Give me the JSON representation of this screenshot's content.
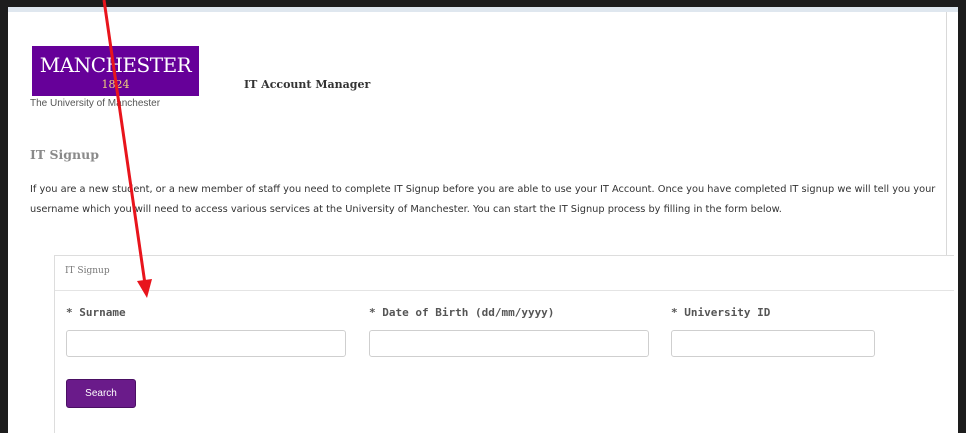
{
  "logo": {
    "wordmark": "MANCHESTER",
    "year": "1824",
    "subtitle": "The University of Manchester"
  },
  "header": {
    "app_title": "IT Account Manager"
  },
  "page": {
    "heading": "IT Signup",
    "intro": "If you are a new student, or a new member of staff you need to complete IT Signup before you are able to use your IT Account. Once you have completed IT signup we will tell you your username which you will need to access various services at the University of Manchester. You can start the IT Signup process by filling in the form below."
  },
  "form": {
    "legend": "IT Signup",
    "fields": [
      {
        "label": "* Surname",
        "value": "",
        "placeholder": ""
      },
      {
        "label": "* Date of Birth (dd/mm/yyyy)",
        "value": "",
        "placeholder": ""
      },
      {
        "label": "* University ID",
        "value": "",
        "placeholder": ""
      }
    ],
    "search_label": "Search"
  },
  "colors": {
    "brand_purple": "#660099",
    "button_purple": "#6a1b8a",
    "logo_year_gold": "#f0d27a",
    "annotation_red": "#e8141c"
  }
}
